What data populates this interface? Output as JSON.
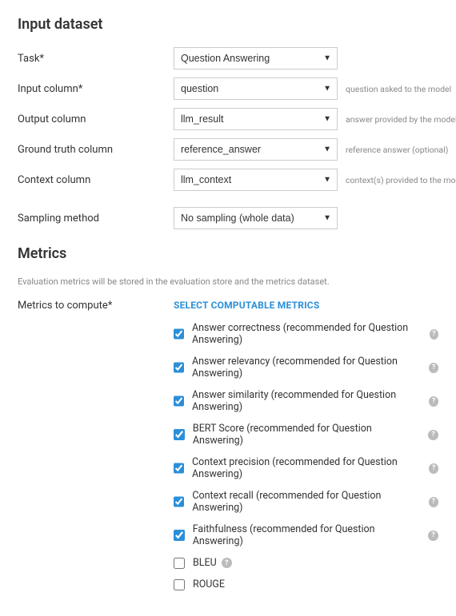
{
  "input_section": {
    "title": "Input dataset",
    "rows": {
      "task": {
        "label": "Task*",
        "value": "Question Answering",
        "hint": ""
      },
      "input": {
        "label": "Input column*",
        "value": "question",
        "hint": "question asked to the model"
      },
      "output": {
        "label": "Output column",
        "value": "llm_result",
        "hint": "answer provided by the model (optional)"
      },
      "truth": {
        "label": "Ground truth column",
        "value": "reference_answer",
        "hint": "reference answer (optional)"
      },
      "context": {
        "label": "Context column",
        "value": "llm_context",
        "hint": "context(s) provided to the model (optional)"
      },
      "sampling": {
        "label": "Sampling method",
        "value": "No sampling (whole data)",
        "hint": ""
      }
    }
  },
  "metrics_section": {
    "title": "Metrics",
    "subtitle": "Evaluation metrics will be stored in the evaluation store and the metrics dataset.",
    "row_label": "Metrics to compute*",
    "select_link": "SELECT COMPUTABLE METRICS",
    "items": [
      {
        "label": "Answer correctness (recommended for Question Answering)",
        "checked": true,
        "help": true
      },
      {
        "label": "Answer relevancy (recommended for Question Answering)",
        "checked": true,
        "help": true
      },
      {
        "label": "Answer similarity (recommended for Question Answering)",
        "checked": true,
        "help": true
      },
      {
        "label": "BERT Score (recommended for Question Answering)",
        "checked": true,
        "help": true
      },
      {
        "label": "Context precision (recommended for Question Answering)",
        "checked": true,
        "help": true
      },
      {
        "label": "Context recall (recommended for Question Answering)",
        "checked": true,
        "help": true
      },
      {
        "label": "Faithfulness (recommended for Question Answering)",
        "checked": true,
        "help": true
      },
      {
        "label": "BLEU",
        "checked": false,
        "help": true
      },
      {
        "label": "ROUGE",
        "checked": false,
        "help": false
      }
    ]
  }
}
